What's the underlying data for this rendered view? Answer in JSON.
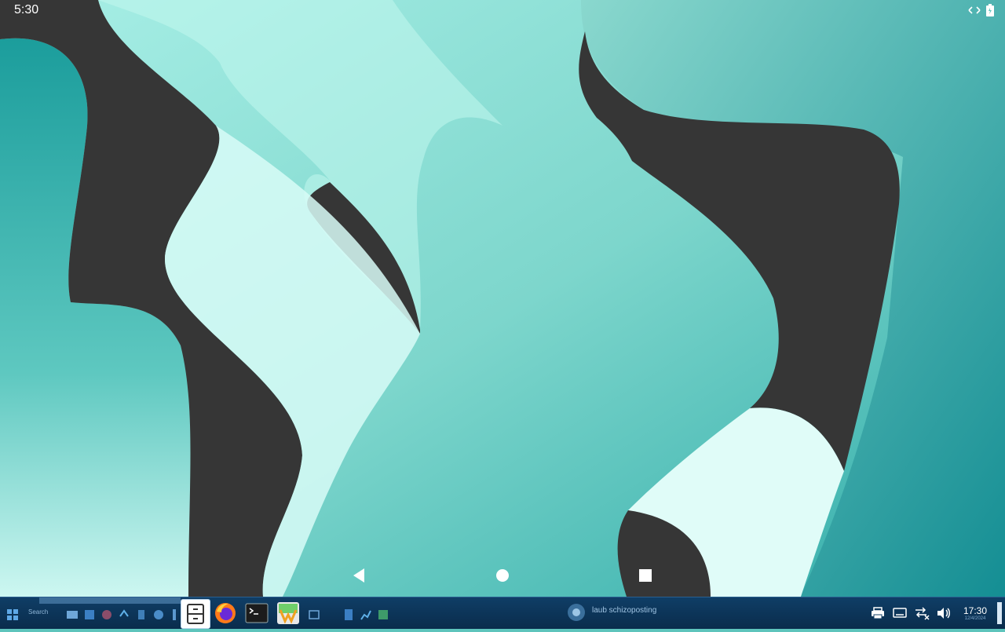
{
  "status_bar": {
    "time": "5:30",
    "icons": [
      "signal-arrows-icon",
      "battery-icon"
    ]
  },
  "nav_bar": {
    "buttons": [
      "back-icon",
      "home-icon",
      "recents-icon"
    ]
  },
  "taskbar": {
    "search_label": "Search",
    "pinned_apps": [
      "file-cabinet-icon",
      "firefox-icon",
      "terminal-icon",
      "wine-icon"
    ],
    "notification_text": "laub schizoposting",
    "clock_time": "17:30",
    "clock_date": "12/4/2024"
  },
  "colors": {
    "teal_light": "#cffbf5",
    "teal_mid": "#7fd6cc",
    "teal_dark": "#1e9a9a",
    "shape_dark": "#363636",
    "taskbar": "#0f3e66"
  }
}
